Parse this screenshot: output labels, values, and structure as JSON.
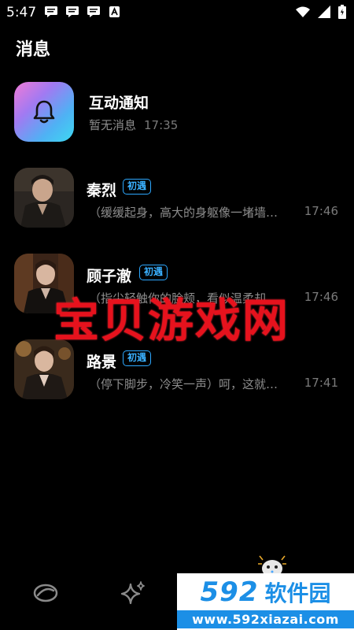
{
  "status_bar": {
    "time": "5:47",
    "icons": [
      "message-icon",
      "message-icon",
      "message-icon",
      "font-icon",
      "wifi-icon",
      "signal-icon",
      "battery-icon"
    ]
  },
  "header": {
    "title": "消息"
  },
  "notification_row": {
    "title": "互动通知",
    "subtitle": "暂无消息",
    "time": "17:35",
    "icon": "bell-icon"
  },
  "conversations": [
    {
      "name": "秦烈",
      "badge": "初遇",
      "preview": "（缓缓起身，高大的身躯像一堵墙…",
      "time": "17:46"
    },
    {
      "name": "顾子澈",
      "badge": "初遇",
      "preview": "（指尖轻触你的脸颊，看似温柔却…",
      "time": "17:46"
    },
    {
      "name": "路景",
      "badge": "初遇",
      "preview": "（停下脚步，冷笑一声）呵，这就…",
      "time": "17:41"
    }
  ],
  "watermark": {
    "text": "宝贝游戏网"
  },
  "bottom_nav": {
    "items": [
      {
        "icon": "planet-icon"
      },
      {
        "icon": "sparkle-icon"
      },
      {
        "icon": "gamepad-icon"
      }
    ]
  },
  "site_logo": {
    "number": "592",
    "name": "软件园",
    "url": "www.592xiazai.com"
  },
  "colors": {
    "accent": "#2da8ff",
    "background": "#000000",
    "watermark": "#e6121d"
  }
}
